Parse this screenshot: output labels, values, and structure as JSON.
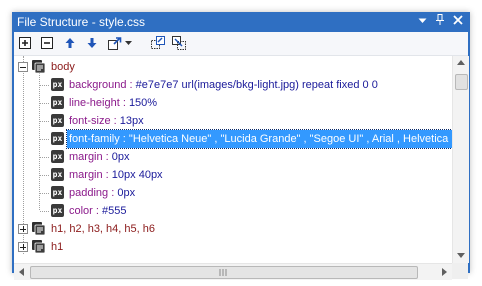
{
  "window": {
    "title": "File Structure - style.css",
    "buttons": {
      "dropdown_icon": "triangle-down",
      "pin_icon": "pin",
      "close_icon": "close-x"
    }
  },
  "toolbar": {
    "items": [
      {
        "name": "expand-all-button",
        "icon": "plus-box"
      },
      {
        "name": "collapse-all-button",
        "icon": "minus-box"
      },
      {
        "name": "move-up-button",
        "icon": "arrow-up"
      },
      {
        "name": "move-down-button",
        "icon": "arrow-down"
      },
      {
        "name": "navigate-button",
        "icon": "export-dropdown"
      },
      {
        "name": "sync-button",
        "icon": "sync"
      },
      {
        "name": "locate-button",
        "icon": "locate"
      }
    ]
  },
  "tree": {
    "body": {
      "selector": "body",
      "expanded": true,
      "properties": [
        {
          "name": "background",
          "value": "#e7e7e7 url(images/bkg-light.jpg) repeat fixed 0 0"
        },
        {
          "name": "line-height",
          "value": "150%"
        },
        {
          "name": "font-size",
          "value": "13px"
        },
        {
          "name": "font-family",
          "value": "\"Helvetica Neue\" , \"Lucida Grande\" , \"Segoe UI\" , Arial , Helvetica ,",
          "selected": true
        },
        {
          "name": "margin",
          "value": "0px"
        },
        {
          "name": "margin",
          "value": "10px 40px"
        },
        {
          "name": "padding",
          "value": "0px"
        },
        {
          "name": "color",
          "value": "#555"
        }
      ]
    },
    "headings": {
      "selector": "h1, h2, h3, h4, h5, h6",
      "expanded": false
    },
    "h1": {
      "selector": "h1",
      "expanded": false
    }
  },
  "colors": {
    "accent": "#2f6fc2",
    "selection": "#3399ff",
    "selector_text": "#8b1a1a",
    "property_name": "#8b1a8b",
    "property_value": "#1a1a9a"
  }
}
